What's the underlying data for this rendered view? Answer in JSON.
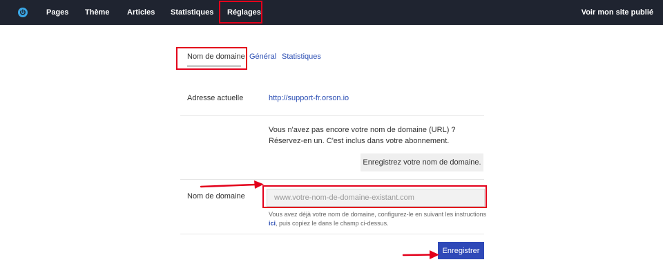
{
  "topbar": {
    "logo_icon": "power-icon",
    "nav": {
      "pages": "Pages",
      "theme": "Thème",
      "articles": "Articles",
      "stats": "Statistiques",
      "settings": "Réglages"
    },
    "view_site": "Voir mon site publié"
  },
  "tabs": {
    "domain": "Nom de domaine",
    "general": "Général",
    "stats": "Statistiques"
  },
  "current_address": {
    "label": "Adresse actuelle",
    "url": "http://support-fr.orson.io"
  },
  "reserve": {
    "text": "Vous n'avez pas encore votre nom de domaine (URL) ? Réservez-en un. C'est inclus dans votre abonnement.",
    "button": "Enregistrez votre nom de domaine."
  },
  "domain_field": {
    "label": "Nom de domaine",
    "placeholder": "www.votre-nom-de-domaine-existant.com",
    "value": "",
    "help_prefix": "Vous avez déjà votre nom de domaine, configurez-le en suivant les instructions ",
    "help_link": "ici",
    "help_suffix": ", puis copiez le dans le champ ci-dessus."
  },
  "submit": {
    "label": "Enregistrer"
  },
  "colors": {
    "topbar_bg": "#1f2430",
    "link": "#2a4db3",
    "primary_button": "#2f49b8",
    "annotation_red": "#e3001b"
  }
}
